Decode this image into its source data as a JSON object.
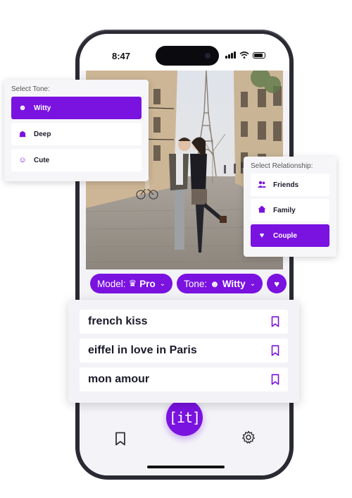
{
  "status_bar": {
    "time": "8:47"
  },
  "chips": {
    "model_label": "Model:",
    "model_value": "Pro",
    "model_icon": "crown-icon",
    "tone_label": "Tone:",
    "tone_value": "Witty",
    "tone_icon": "mask-icon",
    "heart_icon": "heart-icon"
  },
  "tone_panel": {
    "title": "Select Tone:",
    "options": [
      {
        "label": "Witty",
        "icon": "mask-icon",
        "selected": true
      },
      {
        "label": "Deep",
        "icon": "spy-icon",
        "selected": false
      },
      {
        "label": "Cute",
        "icon": "cute-face-icon",
        "selected": false
      }
    ]
  },
  "relationship_panel": {
    "title": "Select Relationship:",
    "options": [
      {
        "label": "Friends",
        "icon": "user-group-icon",
        "selected": false
      },
      {
        "label": "Family",
        "icon": "home-icon",
        "selected": false
      },
      {
        "label": "Couple",
        "icon": "heart-icon",
        "selected": true
      }
    ]
  },
  "suggestions": [
    {
      "text": "french kiss",
      "icon": "bookmark-icon"
    },
    {
      "text": "eiffel in love in Paris",
      "icon": "bookmark-icon"
    },
    {
      "text": "mon amour",
      "icon": "bookmark-icon"
    }
  ],
  "bottom_nav": {
    "fab_label": "[it]",
    "left_icon": "bookmark-icon",
    "right_icon": "gear-icon"
  },
  "colors": {
    "accent": "#7a12e0",
    "phone_frame": "#2a2a33",
    "screen_bg": "#f3f3f7"
  }
}
